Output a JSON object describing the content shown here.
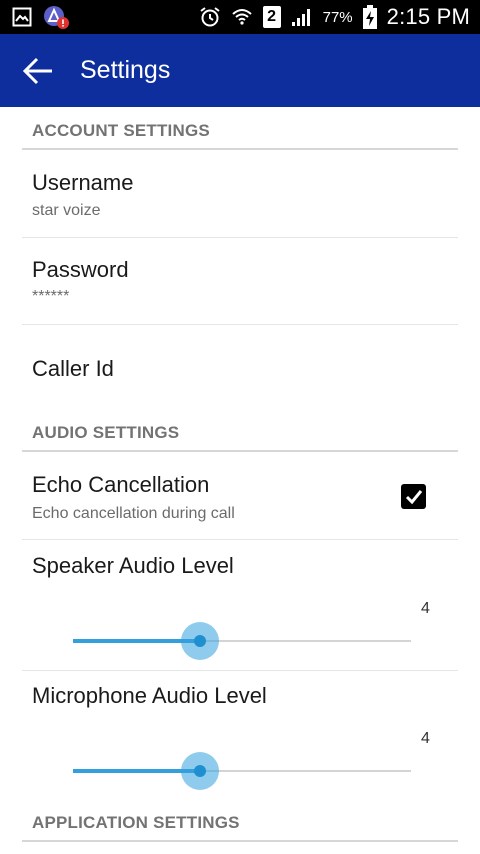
{
  "status_bar": {
    "battery": "77%",
    "sim_slot": "2",
    "time": "2:15 PM",
    "icons": [
      "gallery-icon",
      "app-alert-icon",
      "alarm-icon",
      "wifi-icon",
      "sim-2-icon",
      "signal-icon",
      "battery-charging-icon"
    ]
  },
  "app_bar": {
    "title": "Settings",
    "back_icon": "back-arrow-icon",
    "color": "#0d2e9c"
  },
  "sections": {
    "account": {
      "header": "ACCOUNT SETTINGS",
      "username": {
        "title": "Username",
        "summary": "star voize"
      },
      "password": {
        "title": "Password",
        "summary": "******"
      },
      "caller_id": {
        "title": "Caller Id"
      }
    },
    "audio": {
      "header": "AUDIO SETTINGS",
      "echo": {
        "title": "Echo Cancellation",
        "summary": "Echo cancellation during call",
        "checked": true
      },
      "speaker": {
        "title": "Speaker Audio Level",
        "value": "4",
        "fraction": 0.375
      },
      "microphone": {
        "title": "Microphone Audio Level",
        "value": "4",
        "fraction": 0.375
      }
    },
    "application": {
      "header": "APPLICATION SETTINGS"
    }
  },
  "colors": {
    "accent": "#33a0dd",
    "section_header": "#737373"
  }
}
